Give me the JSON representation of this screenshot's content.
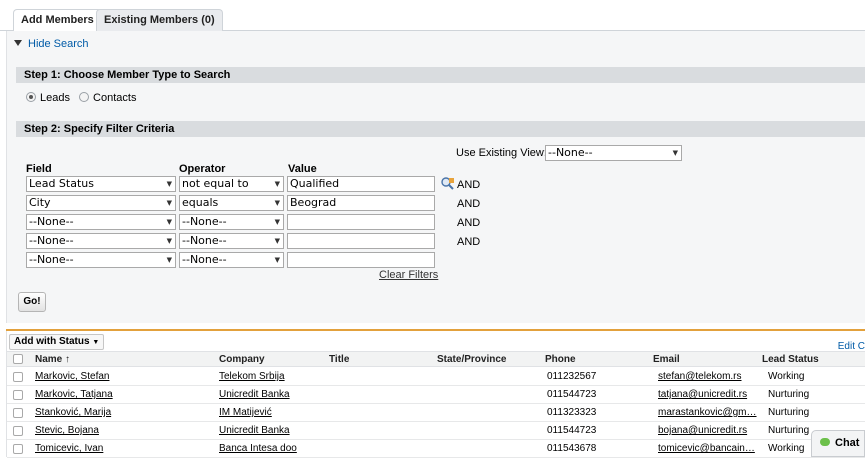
{
  "tabs": [
    "Add Members",
    "Existing Members (0)"
  ],
  "hide_search": "Hide Search",
  "step1": {
    "title": "Step 1: Choose Member Type to Search",
    "options": [
      {
        "label": "Leads",
        "selected": true
      },
      {
        "label": "Contacts",
        "selected": false
      }
    ]
  },
  "step2": {
    "title": "Step 2: Specify Filter Criteria",
    "view_label": "Use Existing View:",
    "view_value": "--None--",
    "col_field": "Field",
    "col_operator": "Operator",
    "col_value": "Value",
    "filters": [
      {
        "field": "Lead Status",
        "operator": "not equal to",
        "value": "Qualified",
        "and": "AND"
      },
      {
        "field": "City",
        "operator": "equals",
        "value": "Beograd",
        "and": "AND"
      },
      {
        "field": "--None--",
        "operator": "--None--",
        "value": "",
        "and": "AND"
      },
      {
        "field": "--None--",
        "operator": "--None--",
        "value": "",
        "and": "AND"
      },
      {
        "field": "--None--",
        "operator": "--None--",
        "value": "",
        "and": ""
      }
    ],
    "clear_filters": "Clear Filters",
    "go": "Go!"
  },
  "results": {
    "add_with_status": "Add with Status",
    "edit_link": "Edit C",
    "columns": [
      "Name ↑",
      "Company",
      "Title",
      "State/Province",
      "Phone",
      "Email",
      "Lead Status"
    ],
    "rows": [
      {
        "name": "Markovic, Stefan",
        "company": "Telekom Srbija",
        "title": "",
        "state": "",
        "phone": "011232567",
        "email": "stefan@telekom.rs",
        "status": "Working"
      },
      {
        "name": "Markovic, Tatjana",
        "company": "Unicredit Banka",
        "title": "",
        "state": "",
        "phone": "011544723",
        "email": "tatjana@unicredit.rs",
        "status": "Nurturing"
      },
      {
        "name": "Stanković, Marija",
        "company": "IM Matijević",
        "title": "",
        "state": "",
        "phone": "011323323",
        "email": "marastankovic@gm…",
        "status": "Nurturing"
      },
      {
        "name": "Stevic, Bojana",
        "company": "Unicredit Banka",
        "title": "",
        "state": "",
        "phone": "011544723",
        "email": "bojana@unicredit.rs",
        "status": "Nurturing"
      },
      {
        "name": "Tomicevic, Ivan",
        "company": "Banca Intesa doo",
        "title": "",
        "state": "",
        "phone": "011543678",
        "email": "tomicevic@bancain…",
        "status": "Working"
      }
    ]
  },
  "chat_label": "Chat"
}
